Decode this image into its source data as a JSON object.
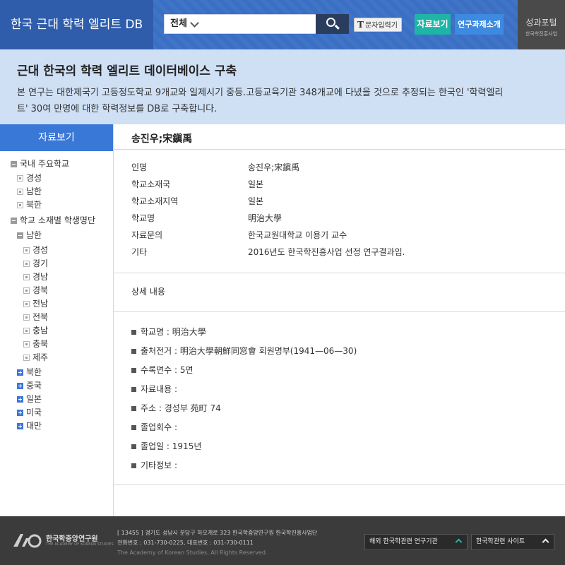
{
  "header": {
    "site_title": "한국 근대 학력 엘리트 DB",
    "search": {
      "scope": "전체",
      "placeholder": ""
    },
    "char_input_label": "문자입력기",
    "char_input_glyph": "T",
    "nav": {
      "view": "자료보기",
      "intro": "연구과제소개"
    },
    "portal": {
      "title": "성과포털",
      "subtitle": "한국학진흥사업"
    }
  },
  "intro": {
    "title": "근대 한국의 학력 엘리트 데이터베이스 구축",
    "description_line1": "본 연구는 대한제국기 고등정도학교 9개교와 일제시기 중등.고등교육기관 348개교에 다녔을 것으로 추정되는 한국인 '학력엘리",
    "description_line2": "트' 30여 만명에 대한 학력정보를 DB로 구축합니다."
  },
  "sidebar": {
    "title": "자료보기",
    "tree": [
      {
        "label": "국내 주요학교",
        "state": "expanded"
      },
      {
        "label": "경성",
        "state": "leaf"
      },
      {
        "label": "남한",
        "state": "leaf"
      },
      {
        "label": "북한",
        "state": "leaf"
      },
      {
        "label": "학교 소재별 학생명단",
        "state": "expanded"
      },
      {
        "label": "남한",
        "state": "expanded"
      },
      {
        "label": "경성",
        "state": "leaf"
      },
      {
        "label": "경기",
        "state": "leaf"
      },
      {
        "label": "경남",
        "state": "leaf"
      },
      {
        "label": "경북",
        "state": "leaf"
      },
      {
        "label": "전남",
        "state": "leaf"
      },
      {
        "label": "전북",
        "state": "leaf"
      },
      {
        "label": "충남",
        "state": "leaf"
      },
      {
        "label": "충북",
        "state": "leaf"
      },
      {
        "label": "제주",
        "state": "leaf"
      },
      {
        "label": "북한",
        "state": "collapsed"
      },
      {
        "label": "중국",
        "state": "collapsed"
      },
      {
        "label": "일본",
        "state": "collapsed"
      },
      {
        "label": "미국",
        "state": "collapsed"
      },
      {
        "label": "대만",
        "state": "collapsed"
      }
    ]
  },
  "record": {
    "title": "송진우;宋鎭禹",
    "fields": [
      {
        "label": "인명",
        "value": "송진우;宋鎭禹"
      },
      {
        "label": "학교소재국",
        "value": "일본"
      },
      {
        "label": "학교소재지역",
        "value": "일본"
      },
      {
        "label": "학교명",
        "value": "明治大學"
      },
      {
        "label": "자료문의",
        "value": "한국교원대학교 이용기 교수"
      },
      {
        "label": "기타",
        "value": "2016년도 한국학진흥사업 선정 연구결과임."
      }
    ],
    "detail_heading": "상세 내용",
    "details": [
      "학교명 : 明治大學",
      "출처전거 : 明治大學朝鮮同窓會 회원명부(1941—06—30)",
      "수록면수 : 5면",
      "자료내용 :",
      "주소 : 경성부 苑町 74",
      "졸업회수 :",
      "졸업일 : 1915년",
      "기타정보 :"
    ]
  },
  "footer": {
    "org_name": "한국학중앙연구원",
    "org_name_en": "THE ACADEMY OF KOREAN STUDIES",
    "address": "[ 13455 ] 경기도 성남시 분당구 하오개로 323 한국학중앙연구원 한국학진흥사업단",
    "phone": "전화번호 : 031-730-0225, 대표번호 : 031-730-0111",
    "copyright": "The Academy of Korean Studies, All Rights Reserved.",
    "select1": "해외 한국학관련 연구기관",
    "select2": "한국학관련 사이트"
  },
  "colors": {
    "header_blue": "#2f5dab",
    "accent_teal": "#1fb5a6",
    "accent_blue": "#3d8ae0",
    "banner_bg": "#cfe0f5",
    "sidebar_head": "#3a78d8",
    "footer_bg": "#3b3b3b"
  }
}
